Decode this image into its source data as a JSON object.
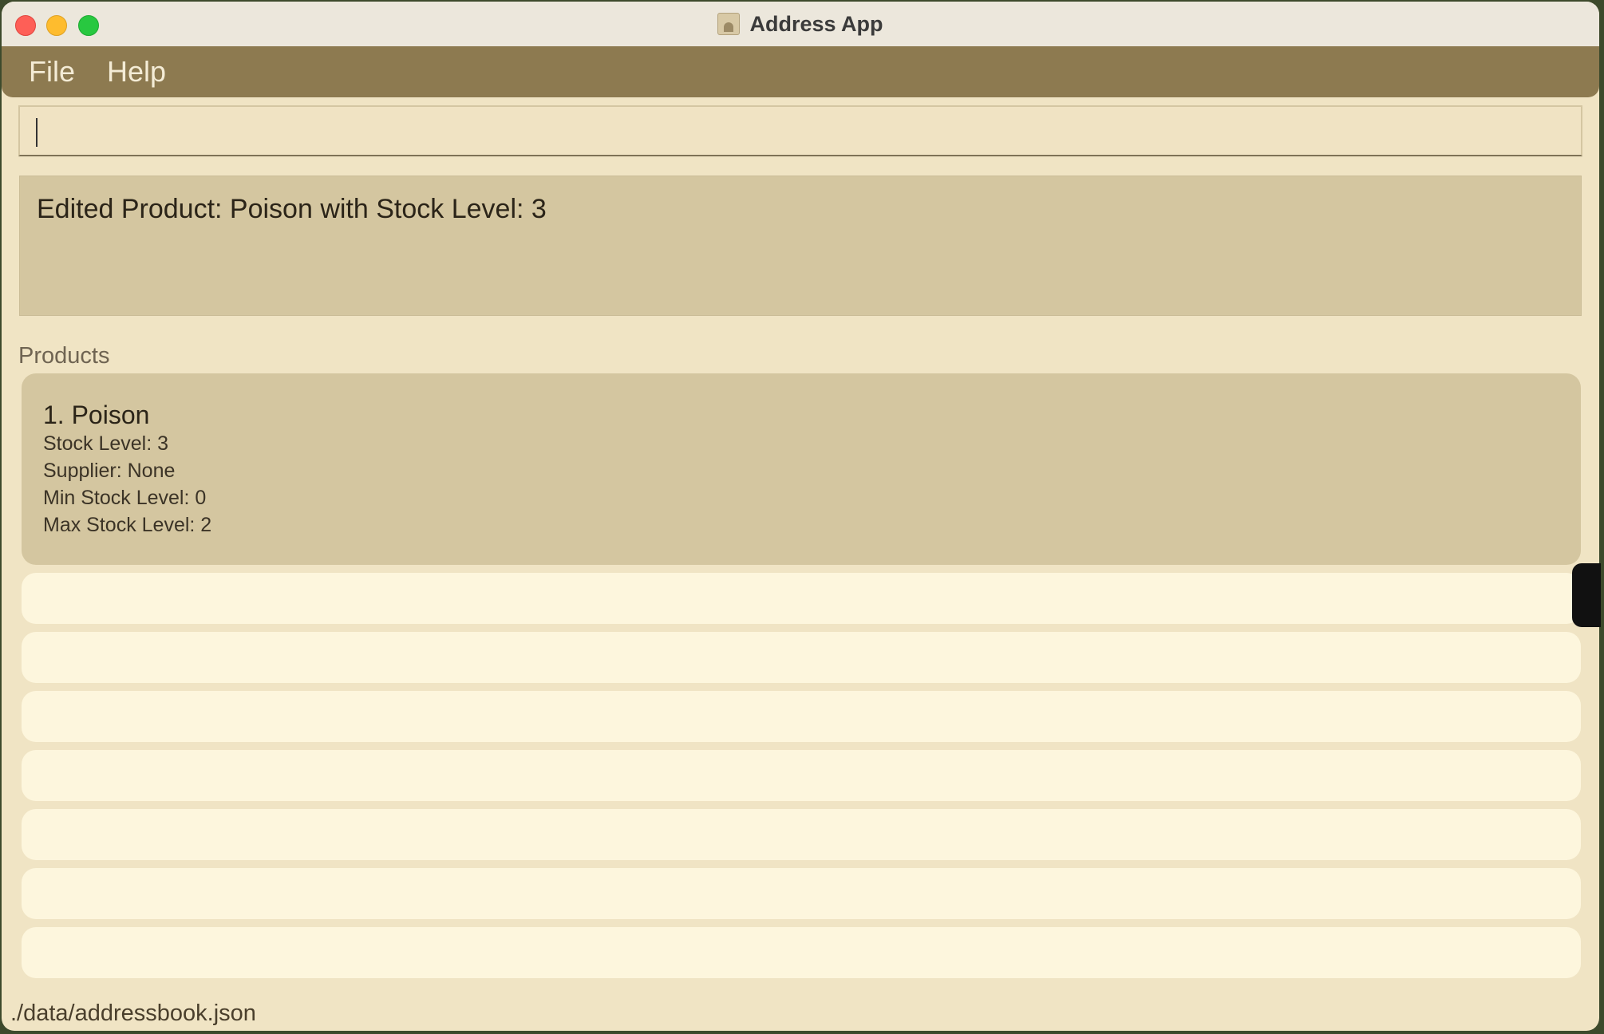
{
  "window": {
    "title": "Address App"
  },
  "menu": {
    "items": [
      "File",
      "Help"
    ]
  },
  "command": {
    "value": "",
    "placeholder": ""
  },
  "result": {
    "message": "Edited Product: Poison with Stock Level: 3"
  },
  "products": {
    "label": "Products",
    "items": [
      {
        "name": "1. Poison",
        "stock": "Stock Level: 3",
        "supplier": "Supplier: None",
        "min_stock": "Min Stock Level: 0",
        "max_stock": "Max Stock Level: 2"
      }
    ]
  },
  "status": {
    "path": "./data/addressbook.json"
  },
  "colors": {
    "menubar": "#8d7a50",
    "background": "#f0e4c4",
    "card": "#d4c6a0",
    "empty_row": "#fdf6dd"
  }
}
